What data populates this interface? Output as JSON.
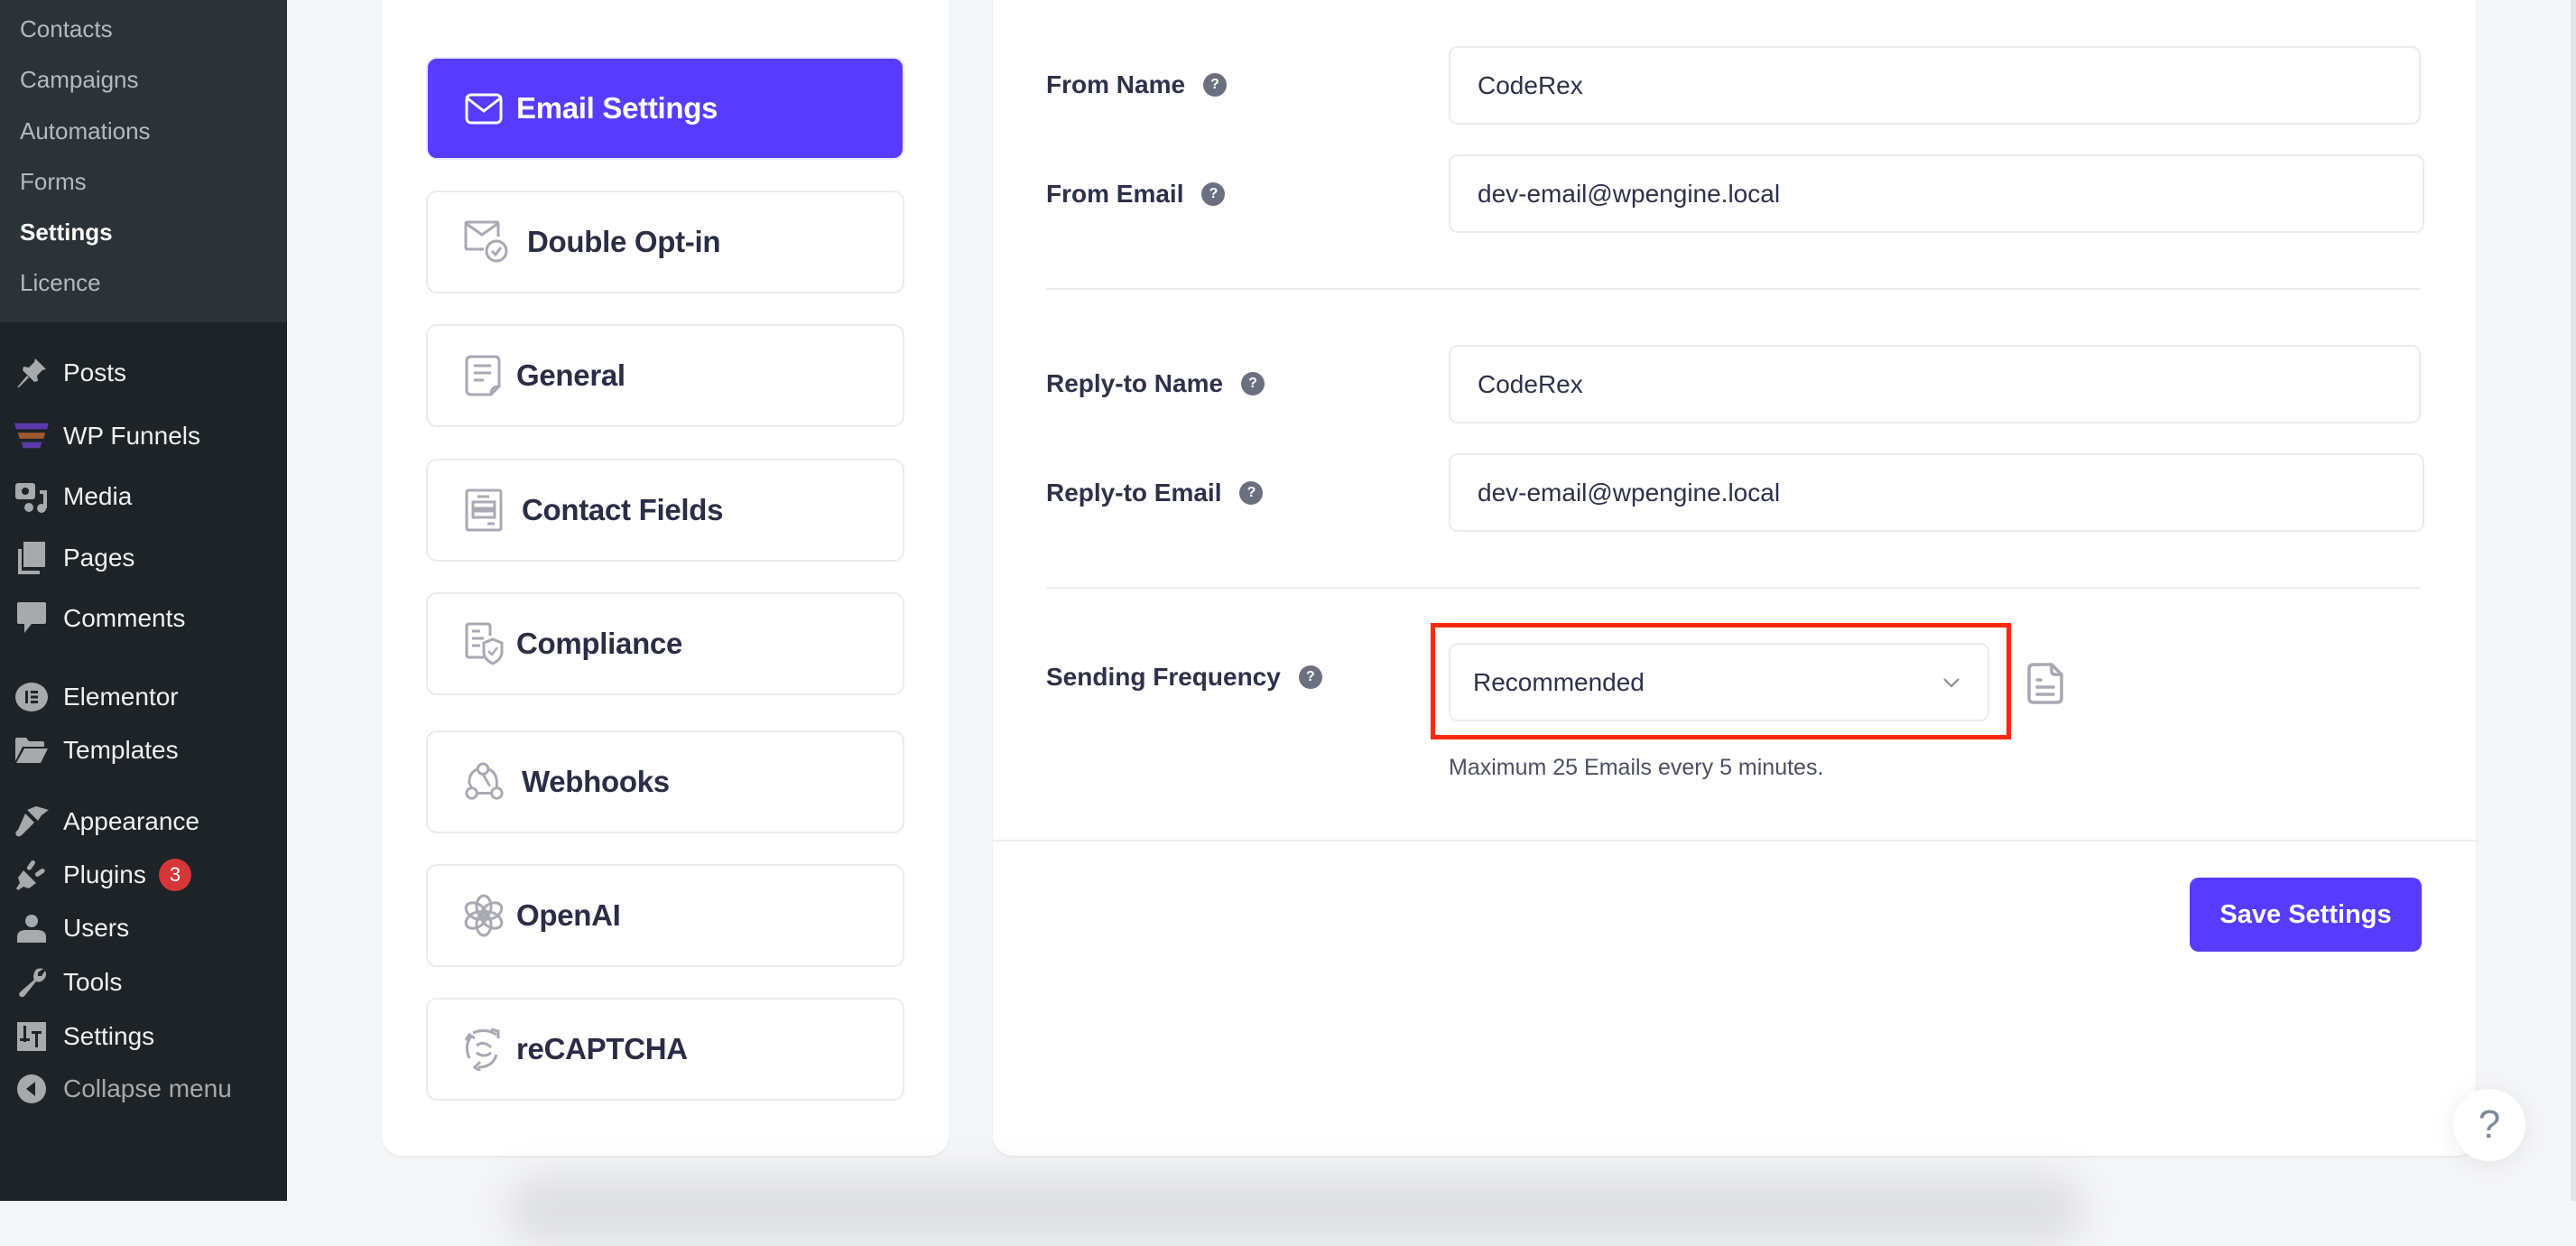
{
  "wp_sidebar": {
    "submenu": [
      {
        "label": "Contacts",
        "active": false
      },
      {
        "label": "Campaigns",
        "active": false
      },
      {
        "label": "Automations",
        "active": false
      },
      {
        "label": "Forms",
        "active": false
      },
      {
        "label": "Settings",
        "active": true
      },
      {
        "label": "Licence",
        "active": false
      }
    ],
    "menu": [
      {
        "label": "Posts",
        "icon": "pin-icon"
      },
      {
        "label": "WP Funnels",
        "icon": "funnel-icon"
      },
      {
        "label": "Media",
        "icon": "media-icon"
      },
      {
        "label": "Pages",
        "icon": "pages-icon"
      },
      {
        "label": "Comments",
        "icon": "comment-icon"
      },
      {
        "label": "Elementor",
        "icon": "elementor-icon"
      },
      {
        "label": "Templates",
        "icon": "folder-icon"
      },
      {
        "label": "Appearance",
        "icon": "brush-icon"
      },
      {
        "label": "Plugins",
        "icon": "plug-icon",
        "badge": "3"
      },
      {
        "label": "Users",
        "icon": "user-icon"
      },
      {
        "label": "Tools",
        "icon": "wrench-icon"
      },
      {
        "label": "Settings",
        "icon": "settings-icon"
      },
      {
        "label": "Collapse menu",
        "icon": "collapse-icon"
      }
    ]
  },
  "settings_nav": {
    "items": [
      {
        "label": "Email Settings",
        "icon": "envelope-icon",
        "active": true
      },
      {
        "label": "Double Opt-in",
        "icon": "envelope-check-icon",
        "active": false
      },
      {
        "label": "General",
        "icon": "document-icon",
        "active": false
      },
      {
        "label": "Contact Fields",
        "icon": "form-fields-icon",
        "active": false
      },
      {
        "label": "Compliance",
        "icon": "shield-document-icon",
        "active": false
      },
      {
        "label": "Webhooks",
        "icon": "webhook-icon",
        "active": false
      },
      {
        "label": "OpenAI",
        "icon": "openai-icon",
        "active": false
      },
      {
        "label": "reCAPTCHA",
        "icon": "recaptcha-icon",
        "active": false
      }
    ]
  },
  "form": {
    "fields": [
      {
        "label": "From Name",
        "value": "CodeRex"
      },
      {
        "label": "From Email",
        "value": "dev-email@wpengine.local"
      },
      {
        "label": "Reply-to Name",
        "value": "CodeRex"
      },
      {
        "label": "Reply-to Email",
        "value": "dev-email@wpengine.local"
      }
    ],
    "help_glyph": "?",
    "sending_frequency": {
      "label": "Sending Frequency",
      "selected": "Recommended",
      "help_text": "Maximum 25 Emails every 5 minutes."
    },
    "save_label": "Save Settings"
  },
  "help_fab": "?",
  "colors": {
    "accent": "#573cff",
    "highlight": "#ff2a0e",
    "badge": "#d63638",
    "sidebar_bg": "#1d2327",
    "submenu_bg": "#2c3338"
  }
}
